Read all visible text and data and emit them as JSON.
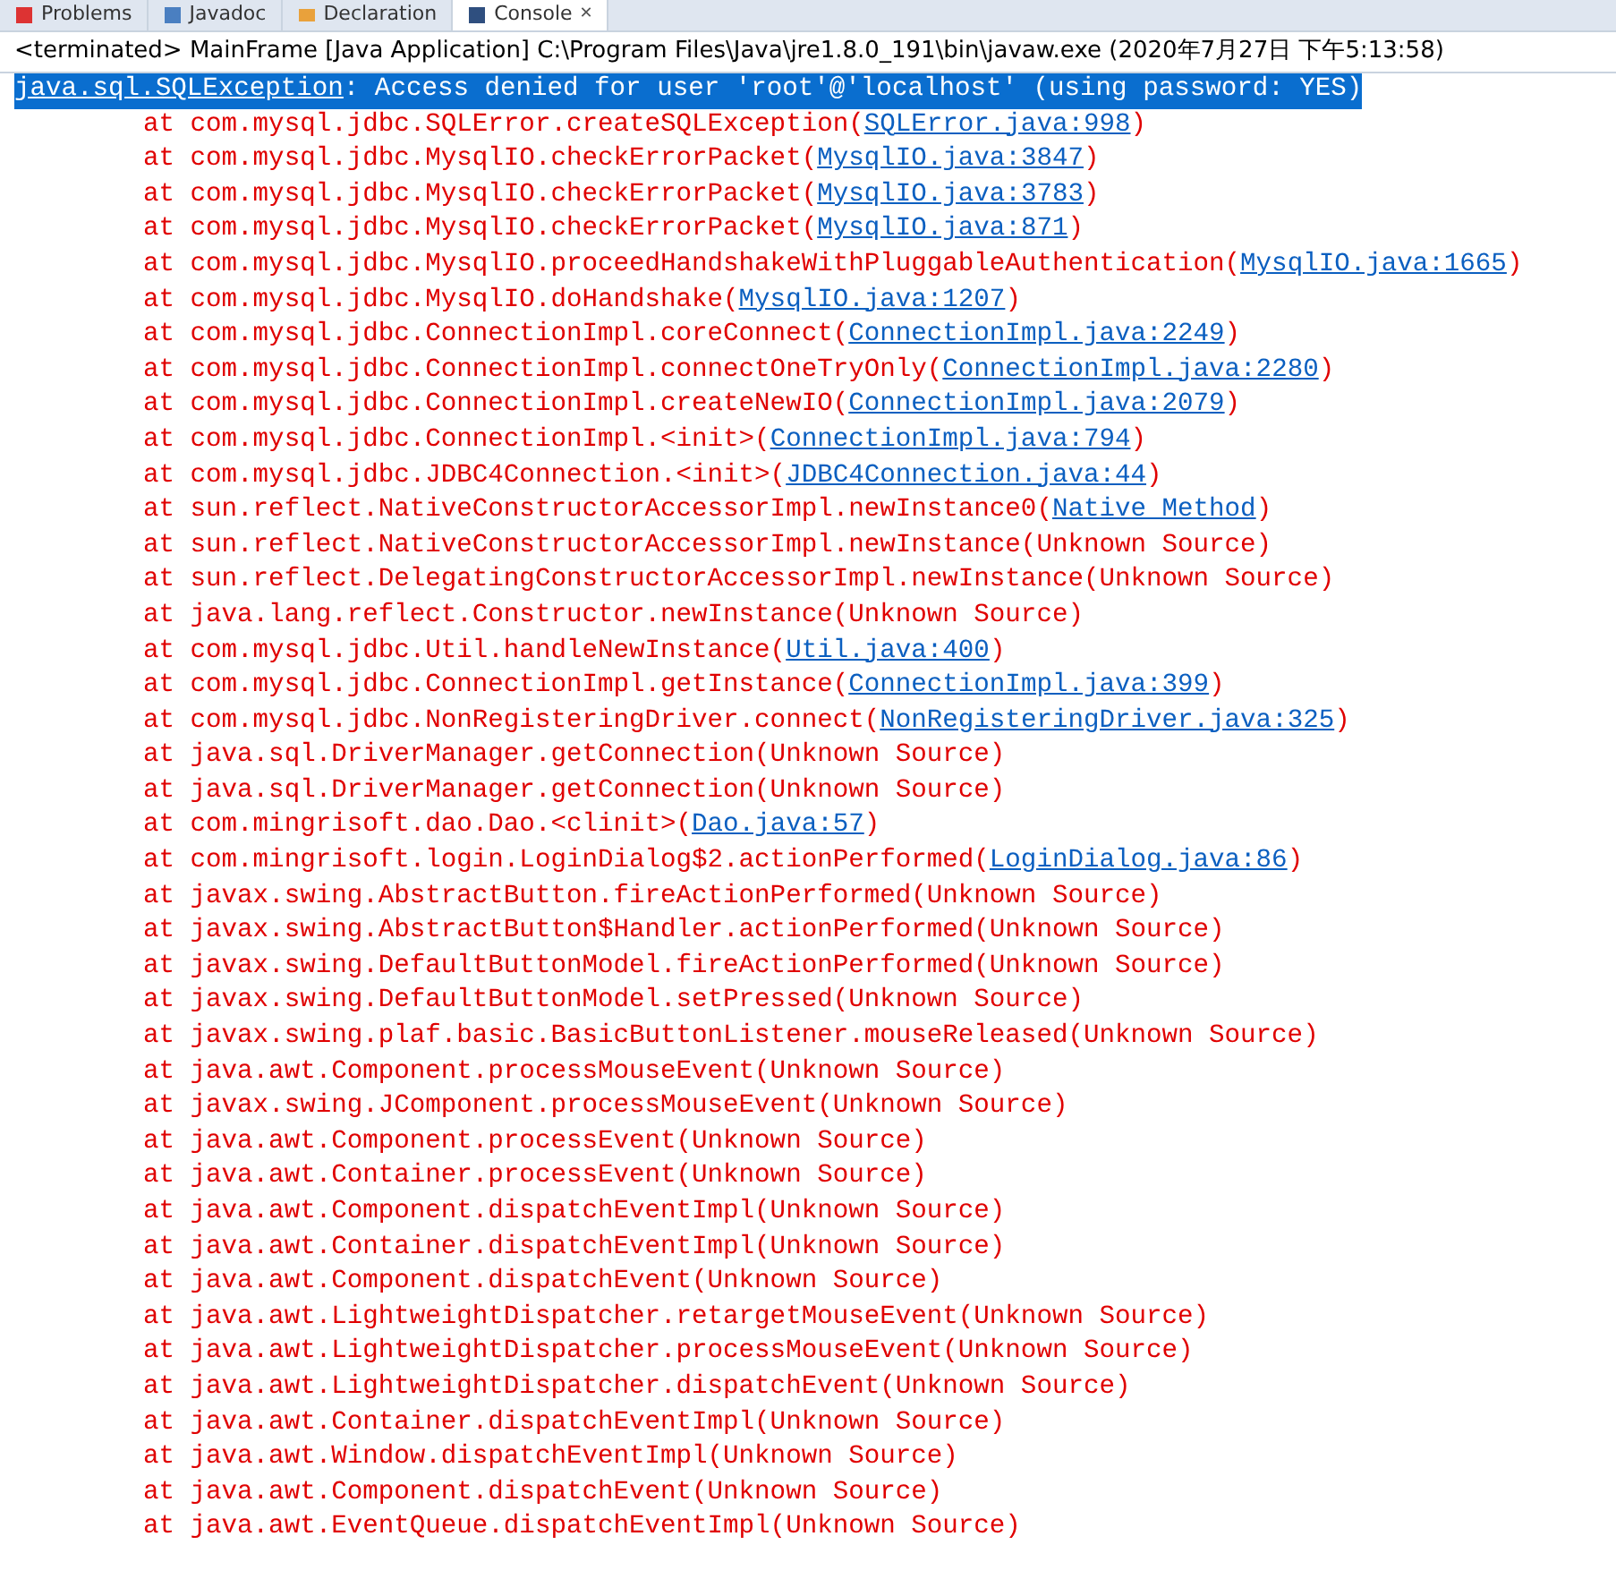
{
  "tabs": [
    {
      "label": "Problems",
      "selected": false,
      "closable": false
    },
    {
      "label": "Javadoc",
      "selected": false,
      "closable": false
    },
    {
      "label": "Declaration",
      "selected": false,
      "closable": false
    },
    {
      "label": "Console",
      "selected": true,
      "closable": true,
      "close": "✕"
    }
  ],
  "header": "<terminated> MainFrame [Java Application] C:\\Program Files\\Java\\jre1.8.0_191\\bin\\javaw.exe (2020年7月27日 下午5:13:58)",
  "exception": {
    "link": "java.sql.SQLException",
    "message": ": Access denied for user 'root'@'localhost' (using password: YES)",
    "selected": true
  },
  "frames": [
    {
      "prefix": "at com.mysql.jdbc.SQLError.createSQLException(",
      "source": "SQLError.java:998",
      "linked": true,
      "suffix": ")"
    },
    {
      "prefix": "at com.mysql.jdbc.MysqlIO.checkErrorPacket(",
      "source": "MysqlIO.java:3847",
      "linked": true,
      "suffix": ")"
    },
    {
      "prefix": "at com.mysql.jdbc.MysqlIO.checkErrorPacket(",
      "source": "MysqlIO.java:3783",
      "linked": true,
      "suffix": ")"
    },
    {
      "prefix": "at com.mysql.jdbc.MysqlIO.checkErrorPacket(",
      "source": "MysqlIO.java:871",
      "linked": true,
      "suffix": ")"
    },
    {
      "prefix": "at com.mysql.jdbc.MysqlIO.proceedHandshakeWithPluggableAuthentication(",
      "source": "MysqlIO.java:1665",
      "linked": true,
      "suffix": ")"
    },
    {
      "prefix": "at com.mysql.jdbc.MysqlIO.doHandshake(",
      "source": "MysqlIO.java:1207",
      "linked": true,
      "suffix": ")"
    },
    {
      "prefix": "at com.mysql.jdbc.ConnectionImpl.coreConnect(",
      "source": "ConnectionImpl.java:2249",
      "linked": true,
      "suffix": ")"
    },
    {
      "prefix": "at com.mysql.jdbc.ConnectionImpl.connectOneTryOnly(",
      "source": "ConnectionImpl.java:2280",
      "linked": true,
      "suffix": ")"
    },
    {
      "prefix": "at com.mysql.jdbc.ConnectionImpl.createNewIO(",
      "source": "ConnectionImpl.java:2079",
      "linked": true,
      "suffix": ")"
    },
    {
      "prefix": "at com.mysql.jdbc.ConnectionImpl.<init>(",
      "source": "ConnectionImpl.java:794",
      "linked": true,
      "suffix": ")"
    },
    {
      "prefix": "at com.mysql.jdbc.JDBC4Connection.<init>(",
      "source": "JDBC4Connection.java:44",
      "linked": true,
      "suffix": ")"
    },
    {
      "prefix": "at sun.reflect.NativeConstructorAccessorImpl.newInstance0(",
      "source": "Native Method",
      "linked": true,
      "suffix": ")"
    },
    {
      "prefix": "at sun.reflect.NativeConstructorAccessorImpl.newInstance(Unknown Source)",
      "linked": false
    },
    {
      "prefix": "at sun.reflect.DelegatingConstructorAccessorImpl.newInstance(Unknown Source)",
      "linked": false
    },
    {
      "prefix": "at java.lang.reflect.Constructor.newInstance(Unknown Source)",
      "linked": false
    },
    {
      "prefix": "at com.mysql.jdbc.Util.handleNewInstance(",
      "source": "Util.java:400",
      "linked": true,
      "suffix": ")"
    },
    {
      "prefix": "at com.mysql.jdbc.ConnectionImpl.getInstance(",
      "source": "ConnectionImpl.java:399",
      "linked": true,
      "suffix": ")"
    },
    {
      "prefix": "at com.mysql.jdbc.NonRegisteringDriver.connect(",
      "source": "NonRegisteringDriver.java:325",
      "linked": true,
      "suffix": ")"
    },
    {
      "prefix": "at java.sql.DriverManager.getConnection(Unknown Source)",
      "linked": false
    },
    {
      "prefix": "at java.sql.DriverManager.getConnection(Unknown Source)",
      "linked": false
    },
    {
      "prefix": "at com.mingrisoft.dao.Dao.<clinit>(",
      "source": "Dao.java:57",
      "linked": true,
      "suffix": ")"
    },
    {
      "prefix": "at com.mingrisoft.login.LoginDialog$2.actionPerformed(",
      "source": "LoginDialog.java:86",
      "linked": true,
      "suffix": ")"
    },
    {
      "prefix": "at javax.swing.AbstractButton.fireActionPerformed(Unknown Source)",
      "linked": false
    },
    {
      "prefix": "at javax.swing.AbstractButton$Handler.actionPerformed(Unknown Source)",
      "linked": false
    },
    {
      "prefix": "at javax.swing.DefaultButtonModel.fireActionPerformed(Unknown Source)",
      "linked": false
    },
    {
      "prefix": "at javax.swing.DefaultButtonModel.setPressed(Unknown Source)",
      "linked": false
    },
    {
      "prefix": "at javax.swing.plaf.basic.BasicButtonListener.mouseReleased(Unknown Source)",
      "linked": false
    },
    {
      "prefix": "at java.awt.Component.processMouseEvent(Unknown Source)",
      "linked": false
    },
    {
      "prefix": "at javax.swing.JComponent.processMouseEvent(Unknown Source)",
      "linked": false
    },
    {
      "prefix": "at java.awt.Component.processEvent(Unknown Source)",
      "linked": false
    },
    {
      "prefix": "at java.awt.Container.processEvent(Unknown Source)",
      "linked": false
    },
    {
      "prefix": "at java.awt.Component.dispatchEventImpl(Unknown Source)",
      "linked": false
    },
    {
      "prefix": "at java.awt.Container.dispatchEventImpl(Unknown Source)",
      "linked": false
    },
    {
      "prefix": "at java.awt.Component.dispatchEvent(Unknown Source)",
      "linked": false
    },
    {
      "prefix": "at java.awt.LightweightDispatcher.retargetMouseEvent(Unknown Source)",
      "linked": false
    },
    {
      "prefix": "at java.awt.LightweightDispatcher.processMouseEvent(Unknown Source)",
      "linked": false
    },
    {
      "prefix": "at java.awt.LightweightDispatcher.dispatchEvent(Unknown Source)",
      "linked": false
    },
    {
      "prefix": "at java.awt.Container.dispatchEventImpl(Unknown Source)",
      "linked": false
    },
    {
      "prefix": "at java.awt.Window.dispatchEventImpl(Unknown Source)",
      "linked": false
    },
    {
      "prefix": "at java.awt.Component.dispatchEvent(Unknown Source)",
      "linked": false
    },
    {
      "prefix": "at java.awt.EventQueue.dispatchEventImpl(Unknown Source)",
      "linked": false
    }
  ]
}
